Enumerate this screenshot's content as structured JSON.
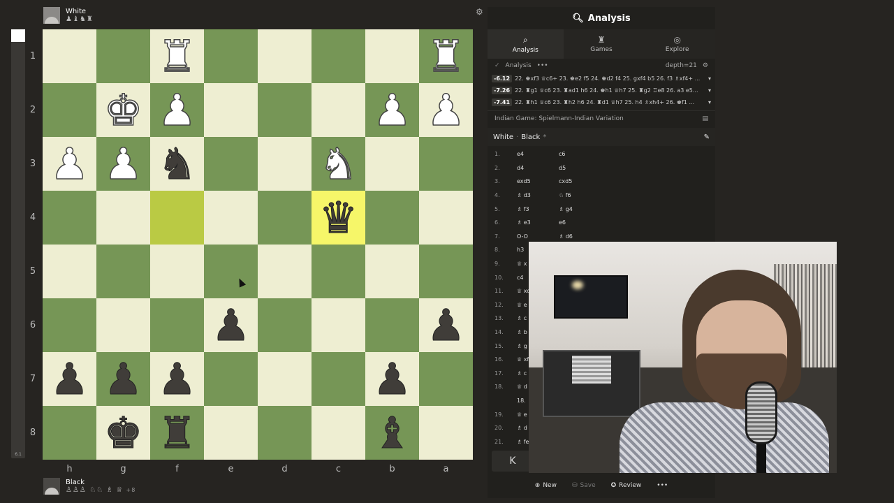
{
  "players": {
    "top": {
      "name": "White",
      "captured": "♟♝♞♜",
      "avatar_icon": "user-avatar-icon"
    },
    "bottom": {
      "name": "Black",
      "captured": "♙♙♙ ♘♘ ♗ ♕",
      "material": "+8",
      "avatar_icon": "user-avatar-icon"
    }
  },
  "eval_bar": {
    "label": "6.1",
    "white_fraction": 0.03
  },
  "board": {
    "ranks": [
      "1",
      "2",
      "3",
      "4",
      "5",
      "6",
      "7",
      "8"
    ],
    "files": [
      "h",
      "g",
      "f",
      "e",
      "d",
      "c",
      "b",
      "a"
    ],
    "rows": [
      [
        "",
        "",
        "wR",
        "",
        "",
        "",
        "",
        "wR"
      ],
      [
        "",
        "wK",
        "wP",
        "",
        "",
        "",
        "wP",
        "wP"
      ],
      [
        "wP",
        "wP",
        "bN",
        "",
        "",
        "wN",
        "",
        ""
      ],
      [
        "",
        "",
        "",
        "",
        "",
        "bQ",
        "",
        ""
      ],
      [
        "",
        "",
        "",
        "",
        "",
        "",
        "",
        ""
      ],
      [
        "",
        "",
        "",
        "bP",
        "",
        "",
        "",
        "bP"
      ],
      [
        "bP",
        "bP",
        "bP",
        "",
        "",
        "",
        "bP",
        ""
      ],
      [
        "",
        "bK",
        "bR",
        "",
        "",
        "",
        "bB",
        ""
      ]
    ],
    "highlights": [
      {
        "row": 3,
        "col": 2,
        "kind": "from"
      },
      {
        "row": 3,
        "col": 5,
        "kind": "to"
      }
    ],
    "colors": {
      "light": "#eeeed2",
      "dark": "#769656",
      "from": "#baca44",
      "to": "#f6f669"
    }
  },
  "panel": {
    "title": "Analysis",
    "tabs": [
      {
        "label": "Analysis",
        "icon": "analysis-icon",
        "active": true
      },
      {
        "label": "Games",
        "icon": "games-icon",
        "active": false
      },
      {
        "label": "Explore",
        "icon": "explore-icon",
        "active": false
      }
    ],
    "engine": {
      "label": "Analysis",
      "more": "•••",
      "depth": "depth=21"
    },
    "lines": [
      {
        "score": "-6.12",
        "text": "22. ♚xf3 ♕c6+ 23. ♚e2 f5 24. ♚d2 f4 25. gxf4 b5 26. f3 ♗xf4+ ..."
      },
      {
        "score": "-7.26",
        "text": "22. ♜g1 ♕c6 23. ♜ad1 h6 24. ♚h1 ♕h7 25. ♜g2 ♖e8 26. a3 e5..."
      },
      {
        "score": "-7.41",
        "text": "22. ♜h1 ♕c6 23. ♜h2 h6 24. ♜d1 ♕h7 25. h4 ♗xh4+ 26. ♚f1 ..."
      }
    ],
    "opening": "Indian Game: Spielmann-Indian Variation",
    "pgn": {
      "white": "White",
      "sep": "·",
      "black": "Black",
      "star": "*"
    },
    "moves": [
      {
        "n": "1.",
        "w": "e4",
        "b": "c6"
      },
      {
        "n": "2.",
        "w": "d4",
        "b": "d5"
      },
      {
        "n": "3.",
        "w": "exd5",
        "b": "cxd5"
      },
      {
        "n": "4.",
        "w": "♗ d3",
        "b": "♘ f6"
      },
      {
        "n": "5.",
        "w": "♗ f3",
        "b": "♗ g4"
      },
      {
        "n": "6.",
        "w": "♗ e3",
        "b": "e6"
      },
      {
        "n": "7.",
        "w": "O-O",
        "b": "♗ d6"
      },
      {
        "n": "8.",
        "w": "h3",
        "b": ""
      },
      {
        "n": "9.",
        "w": "♕ x",
        "b": ""
      },
      {
        "n": "10.",
        "w": "c4",
        "b": ""
      },
      {
        "n": "11.",
        "w": "♕ xc",
        "b": ""
      },
      {
        "n": "12.",
        "w": "♕ e",
        "b": ""
      },
      {
        "n": "13.",
        "w": "♗ c",
        "b": ""
      },
      {
        "n": "14.",
        "w": "♗ b",
        "b": ""
      },
      {
        "n": "15.",
        "w": "♗ g",
        "b": ""
      },
      {
        "n": "16.",
        "w": "♕ xf",
        "b": ""
      },
      {
        "n": "17.",
        "w": "♗ c",
        "b": ""
      },
      {
        "n": "18.",
        "w": "♕ d",
        "b": ""
      },
      {
        "n": "",
        "w": "18.",
        "b": ""
      },
      {
        "n": "19.",
        "w": "♕ e",
        "b": ""
      },
      {
        "n": "20.",
        "w": "♗ d",
        "b": ""
      },
      {
        "n": "21.",
        "w": "♗ fe",
        "b": ""
      }
    ],
    "nav_first": "K",
    "bottom": {
      "new": "New",
      "save": "Save",
      "review": "Review",
      "more": "•••"
    }
  }
}
